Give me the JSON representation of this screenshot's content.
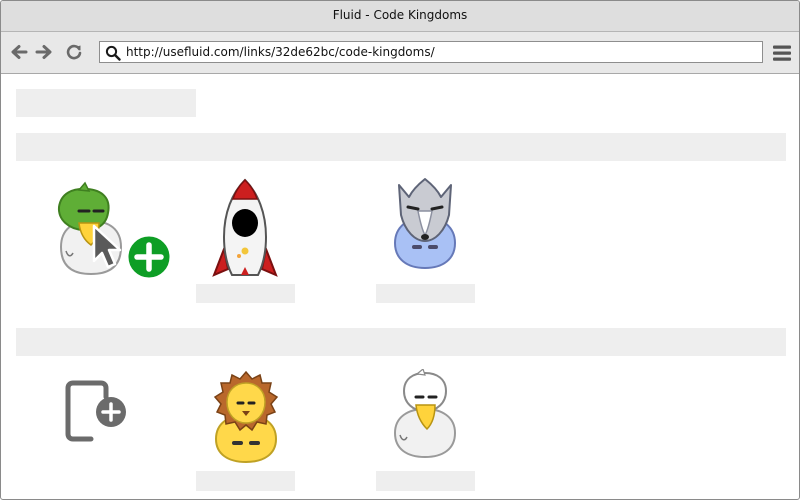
{
  "window": {
    "title": "Fluid - Code Kingdoms"
  },
  "address_bar": {
    "url": "http://usefluid.com/links/32de62bc/code-kingdoms/"
  },
  "toolbar": {
    "back_icon": "arrow-left",
    "forward_icon": "arrow-right",
    "reload_icon": "reload",
    "search_icon": "magnifier",
    "menu_icon": "hamburger"
  },
  "sections": [
    {
      "items": [
        "duck-avatar-selected",
        "rocket-avatar",
        "wolf-avatar"
      ]
    },
    {
      "items": [
        "add-page-icon",
        "lion-avatar",
        "white-duck-avatar"
      ]
    }
  ],
  "colors": {
    "add_button": "#0e9e25",
    "wolf_body": "#a9c1f5",
    "lion_body": "#ffd84a",
    "rocket_red": "#cc1f1f"
  }
}
